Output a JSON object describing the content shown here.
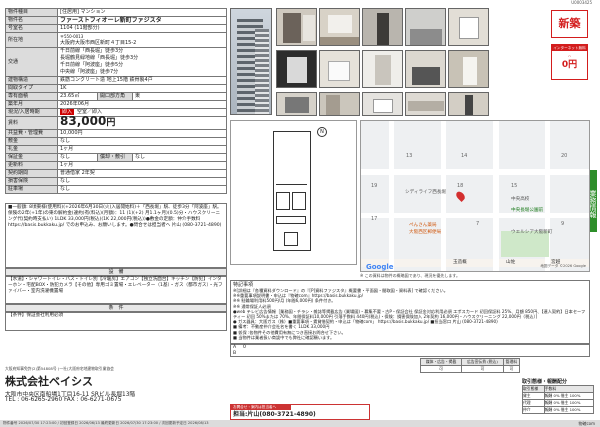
{
  "doc_id": "U0003425",
  "spec": {
    "type": {
      "label": "物件種目",
      "value": "[住居用] マンション"
    },
    "name": {
      "label": "物件名",
      "value": "ファーストフィオーレ新町ファジスタ"
    },
    "room": {
      "label": "号室名",
      "value": "1104 (11階部分)"
    },
    "address": {
      "label": "所在地",
      "zip": "〒550-0013",
      "value": "大阪府大阪市西区新町４丁目15-2"
    },
    "traffic": {
      "label": "交通",
      "lines": [
        "千日前線「西長堀」徒歩3分",
        "長堀鶴見緑地線「西長堀」徒歩3分",
        "千日前線「阿波座」徒歩5分",
        "中央線「阿波座」徒歩7分"
      ]
    },
    "structure": {
      "label": "建物構造",
      "value": "鉄筋コンクリート造 地上15階 鉄骨製4戸"
    },
    "layout": {
      "label": "間取タイプ",
      "value": "1K"
    },
    "area": {
      "label": "専有面積",
      "value": "23.65㎡",
      "sub_label": "開口部方角",
      "sub_value": "東"
    },
    "built": {
      "label": "築年月",
      "value": "2026年06月"
    },
    "status": {
      "label": "現況/入居時期",
      "badge": "即入",
      "value": "空室／即入"
    },
    "rent": {
      "label": "賃料",
      "value": "83,000",
      "unit": "円"
    },
    "common": {
      "label": "共益費・管理費",
      "value": "10,000円"
    },
    "deposit": {
      "label": "敷金",
      "value": "なし"
    },
    "key": {
      "label": "礼金",
      "value": "1ヶ月"
    },
    "shikibiki": {
      "label": "保証金",
      "value": "なし",
      "sub_label": "償却・敷引",
      "sub_value": "なし"
    },
    "renewal": {
      "label": "更新料",
      "value": "1ヶ月"
    },
    "contract": {
      "label": "契約期間",
      "value": "普通借家 2年契"
    },
    "insurance": {
      "label": "損害保険",
      "value": "なし"
    },
    "parking": {
      "label": "駐車場",
      "value": "なし"
    }
  },
  "notes": {
    "other_cost_text": "■一般額: 8頃東様(使用料)(+2026年6月30日(火)入居開始料)＋「西長堀」駅、徒歩3分「阿波座」駅。保険の2年(+1年)の東の解約金(違約)有(料込)(月額)：11 (1)(+2) 月1.1ヶ月)(0.5)分・ハウスクリーニング代(契約時支払い) 1LDK 33,000円(税込)(1K 22,000円(税込))●敷金の定額：仲介手数料 https://basis.bukkaku.jp/ でのお申込み、お願いします。●問合せは担当者へ 片山 (080-3721-4890)",
    "facilities_title": "設　備",
    "facilities_text": "【水道】・シャワートイレ・バス・トイレ別【冷暖房】エアコン【独立洗面台】キッチン【防犯】インターホン・宅配BOX・防犯カメラ【その他】専用ゴミ置場・エレベーター（1基）・ガス（都市ガス）・光ファイバー・室内洗濯機置場",
    "conditions_title": "条　件",
    "conditions_text": "【条件】保証会社利用必須"
  },
  "stamp": {
    "new_label": "新築",
    "badge_top": "インターネット無料",
    "badge_price": "0円"
  },
  "side_tab": "業務情報",
  "map": {
    "labels": [
      "シディライフ西長堀",
      "ぺんさん薬局",
      "大阪西区郵便局",
      "中央長堀公園前",
      "ウエルシア大阪新町",
      "中央高校",
      "玉造概",
      "山佐",
      "宮越"
    ],
    "numbers": [
      "13",
      "14",
      "15",
      "17",
      "18",
      "19",
      "20",
      "7",
      "9"
    ],
    "google": "Google",
    "scale_text": "地図データ ©2026 Google",
    "caption": "※ この資料は物件の概略図であり、現況を優先します。"
  },
  "remarks": {
    "title": "特記事項",
    "lines": [
      "※[詳細は『各種資料ダウンロード』の『[P]資料ファジスタ』概要書・平面図・間取図・資料表] で確認ください。",
      "※※重要事項説明書・申込は『物確com』https://basis.bukkaku.jp/",
      "※※ 駐輪場利用料500円/月 (年間6,000円) 条件付き。",
      "※※ 通常保証人必須",
      "●web テレビ広告情報［業務図・チラシ・雑誌等掲載広告 (業場図)・募集不要・古P・保証会社 保証金対応利用必須 エポスカード 初回保証料 25%、月額 850円、【連人契約】日本セーフティー 初回 50%または 70%、年間保証料10,000円 引落手数料 440円(税込)・保険：損害保険加入 2年契約 16,000円・ハウスクリーニング 22,000円（税込）]",
      "● ガス器具：大阪ガス（株）■重要事項・賃貸借契約・申込は「物確com」 https://basis.bukkaku.jp/ ■担当窓口 片山 (080-3721-4890)",
      "■ 備考：不動産仲介会社名を書く 1LDK 33,000円",
      "■ 仮保 :各物件その他費用有無につき直接お問合せ下さい。",
      "■ 当物件は業者扱い商談中でも弊社に確認願います。"
    ],
    "row_a": "A",
    "row_b": "B",
    "row_a_val": "0"
  },
  "company": {
    "license": "大阪府知事免許(2)第54808号 (一社)大阪府宅地建物取引業協会",
    "name": "株式会社ベイシス",
    "address": "大阪市中央区南船場1丁目16-11 SRビル長堀13階",
    "tel": "TEL : 06-6265-2960 FAX : 06-6271-0675",
    "contact_label": "お問合せ・案内は担当者へ",
    "contact": "担当:片山(080-3721-4890)",
    "footer_left": "物件番号 2026/07/30 17:23:00 / 初回登録日 2026/06/13 最終更新日 2026/07/30 17:23:00 / 次回更新予定日 2026/08/13",
    "footer_right": "物確com"
  },
  "fee_table": {
    "title": "取引態様・報酬配分",
    "head": [
      "取引態様",
      "手数料"
    ],
    "rows": [
      [
        "貸主",
        "報酬 0% 借主 100%"
      ],
      [
        "代理",
        "報酬 0% 借主 100%"
      ],
      [
        "仲介",
        "報酬 0% 借主 100%"
      ]
    ]
  },
  "owner_table": {
    "head": [
      "媒体・広告・掲載",
      "広告宣伝費 (税込)",
      "管理料"
    ],
    "rows": [
      [
        "可",
        "可",
        "可"
      ]
    ]
  }
}
